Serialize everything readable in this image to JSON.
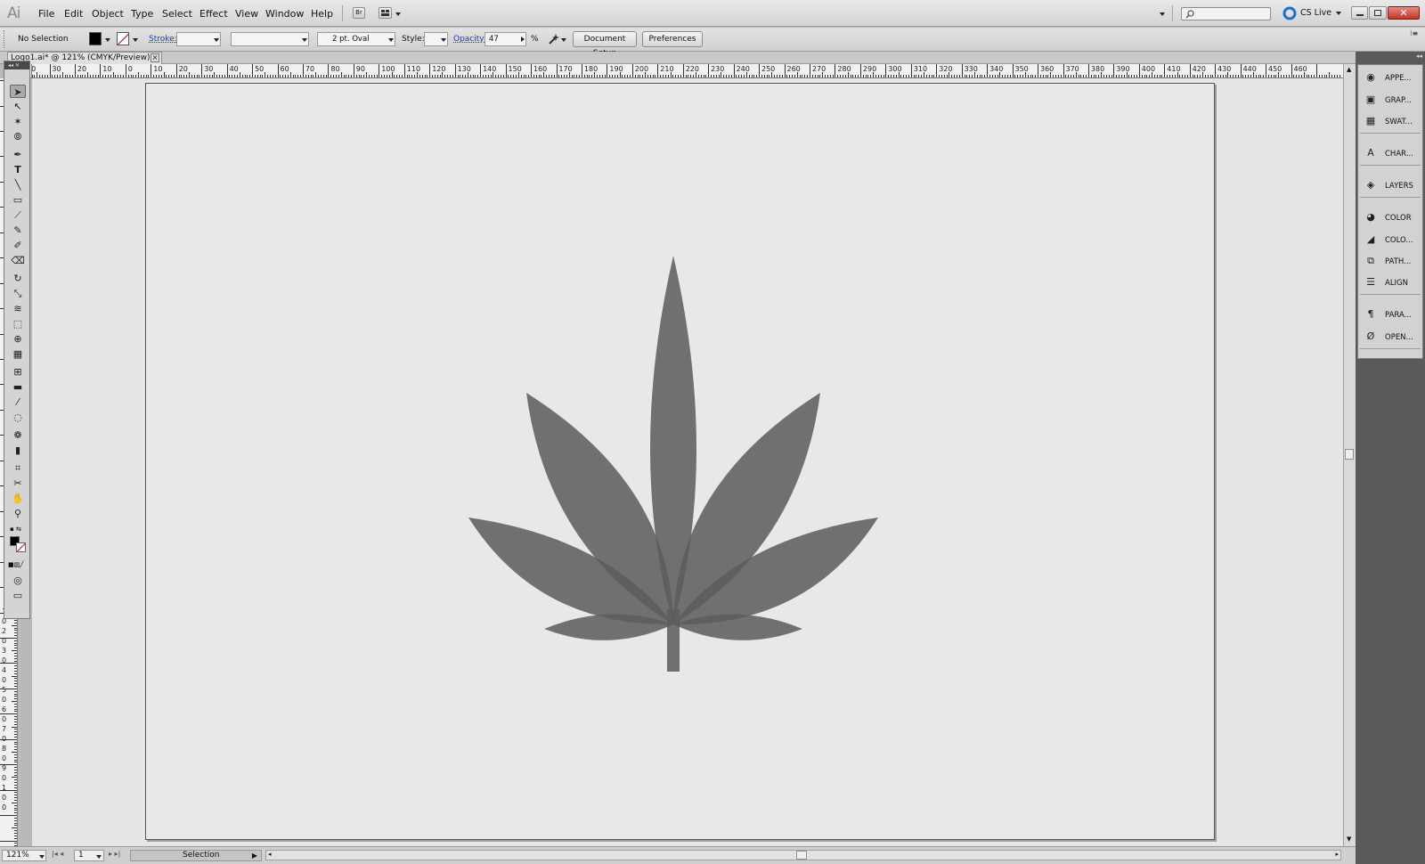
{
  "app": {
    "logo": "Ai"
  },
  "menu": [
    "File",
    "Edit",
    "Object",
    "Type",
    "Select",
    "Effect",
    "View",
    "Window",
    "Help"
  ],
  "menu_icons": {
    "bridge": "Br",
    "arrange": "arrange-documents-icon"
  },
  "search": {
    "placeholder": ""
  },
  "cs_live": "CS Live",
  "control": {
    "selection_status": "No Selection",
    "stroke_label": "Stroke:",
    "brush": "2 pt. Oval",
    "style_label": "Style:",
    "opacity_label": "Opacity:",
    "opacity_value": "47",
    "percent": "%",
    "document_setup": "Document Setup",
    "preferences": "Preferences"
  },
  "document_tab": {
    "title": "Logo1.ai* @ 121% (CMYK/Preview)",
    "close": "×"
  },
  "ruler": {
    "h_labels": [
      "40",
      "30",
      "20",
      "10",
      "0",
      "10",
      "20",
      "30",
      "40",
      "50",
      "60",
      "70",
      "80",
      "90",
      "100",
      "110",
      "120",
      "130",
      "140",
      "150",
      "160",
      "170",
      "180",
      "190",
      "200",
      "210",
      "220",
      "230",
      "240",
      "250",
      "260",
      "270",
      "280",
      "290",
      "300",
      "310",
      "320",
      "330",
      "340",
      "350",
      "360",
      "370",
      "380",
      "390",
      "400",
      "410",
      "420",
      "430",
      "440",
      "450",
      "460"
    ],
    "v_labels": [
      "1",
      "0",
      "2",
      "0",
      "3",
      "0",
      "4",
      "0",
      "5",
      "0",
      "6",
      "0",
      "7",
      "0",
      "8",
      "0",
      "9",
      "0",
      "1",
      "0",
      "0"
    ]
  },
  "panels": [
    {
      "label": "APPE...",
      "icon": "appearance-icon"
    },
    {
      "label": "GRAP...",
      "icon": "graphic-styles-icon"
    },
    {
      "label": "SWAT...",
      "icon": "swatches-icon"
    },
    {
      "label": "CHAR...",
      "icon": "character-icon"
    },
    {
      "label": "LAYERS",
      "icon": "layers-icon"
    },
    {
      "label": "COLOR",
      "icon": "color-icon"
    },
    {
      "label": "COLO...",
      "icon": "color-guide-icon"
    },
    {
      "label": "PATH...",
      "icon": "pathfinder-icon"
    },
    {
      "label": "ALIGN",
      "icon": "align-icon"
    },
    {
      "label": "PARA...",
      "icon": "paragraph-icon"
    },
    {
      "label": "OPEN...",
      "icon": "opentype-icon"
    }
  ],
  "status": {
    "zoom": "121%",
    "page": "1",
    "tool": "Selection"
  },
  "colors": {
    "leaf": "#5a5a5a",
    "leaf_opacity": 0.85,
    "artboard": "#e8e8e8",
    "pasteboard": "#e6e6e6"
  }
}
